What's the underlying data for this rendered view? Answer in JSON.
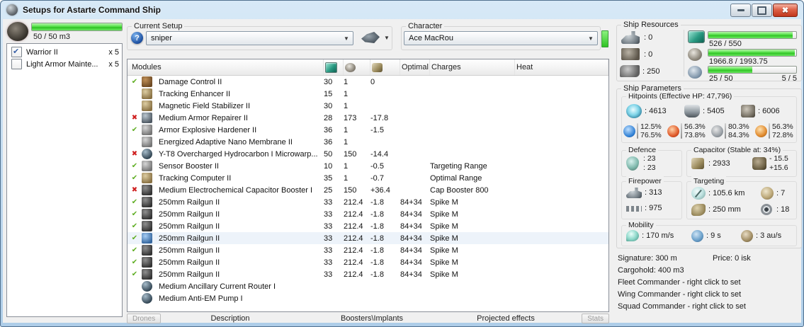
{
  "window": {
    "title": "Setups for Astarte Command Ship"
  },
  "drone_panel": {
    "capacity_text": "50 / 50 m3",
    "capacity_pct": 100,
    "items": [
      {
        "label": "Warrior II",
        "qty": "x 5",
        "checked": true
      },
      {
        "label": "Light Armor Mainte...",
        "qty": "x 5",
        "checked": false
      }
    ]
  },
  "setup": {
    "label": "Current Setup",
    "value": "sniper"
  },
  "character": {
    "label": "Character",
    "value": "Ace MacRou"
  },
  "modules_table": {
    "headers": {
      "modules": "Modules",
      "optimal": "Optimal",
      "charges": "Charges",
      "heat": "Heat"
    },
    "rows": [
      {
        "status": "ok",
        "icon": "damage-control-icon",
        "tone": "brown",
        "n": "Damage Control II",
        "cpu": "30",
        "pg": "1",
        "cap": "0"
      },
      {
        "status": "",
        "icon": "tracking-enhancer-icon",
        "tone": "tan",
        "n": "Tracking Enhancer II",
        "cpu": "15",
        "pg": "1"
      },
      {
        "status": "",
        "icon": "magnetic-field-stabilizer-icon",
        "tone": "tan",
        "n": "Magnetic Field Stabilizer II",
        "cpu": "30",
        "pg": "1"
      },
      {
        "status": "err",
        "icon": "armor-repairer-icon",
        "tone": "steel",
        "n": "Medium Armor Repairer II",
        "cpu": "28",
        "pg": "173",
        "cap": "-17.8"
      },
      {
        "status": "ok",
        "icon": "armor-hardener-icon",
        "tone": "gray",
        "n": "Armor Explosive Hardener II",
        "cpu": "36",
        "pg": "1",
        "cap": "-1.5"
      },
      {
        "status": "",
        "icon": "nano-membrane-icon",
        "tone": "gray",
        "n": "Energized Adaptive Nano Membrane II",
        "cpu": "36",
        "pg": "1"
      },
      {
        "status": "err",
        "icon": "microwarpdrive-icon",
        "tone": "orb",
        "n": "Y-T8 Overcharged Hydrocarbon I Microwarp...",
        "cpu": "50",
        "pg": "150",
        "cap": "-14.4"
      },
      {
        "status": "ok",
        "icon": "sensor-booster-icon",
        "tone": "gray",
        "n": "Sensor Booster II",
        "cpu": "10",
        "pg": "1",
        "cap": "-0.5",
        "chg": "Targeting Range"
      },
      {
        "status": "ok",
        "icon": "tracking-computer-icon",
        "tone": "tan",
        "n": "Tracking Computer II",
        "cpu": "35",
        "pg": "1",
        "cap": "-0.7",
        "chg": "Optimal Range"
      },
      {
        "status": "err",
        "icon": "capacitor-booster-icon",
        "tone": "dark",
        "n": "Medium Electrochemical Capacitor Booster I",
        "cpu": "25",
        "pg": "150",
        "cap": "+36.4",
        "chg": "Cap Booster 800"
      },
      {
        "status": "ok",
        "icon": "railgun-icon",
        "tone": "dark",
        "n": "250mm Railgun II",
        "cpu": "33",
        "pg": "212.4",
        "cap": "-1.8",
        "opt": "84+34",
        "chg": "Spike M"
      },
      {
        "status": "ok",
        "icon": "railgun-icon",
        "tone": "dark",
        "n": "250mm Railgun II",
        "cpu": "33",
        "pg": "212.4",
        "cap": "-1.8",
        "opt": "84+34",
        "chg": "Spike M"
      },
      {
        "status": "ok",
        "icon": "railgun-icon",
        "tone": "dark",
        "n": "250mm Railgun II",
        "cpu": "33",
        "pg": "212.4",
        "cap": "-1.8",
        "opt": "84+34",
        "chg": "Spike M"
      },
      {
        "status": "ok",
        "icon": "railgun-icon",
        "tone": "blue",
        "n": "250mm Railgun II",
        "cpu": "33",
        "pg": "212.4",
        "cap": "-1.8",
        "opt": "84+34",
        "chg": "Spike M",
        "sel": true
      },
      {
        "status": "ok",
        "icon": "railgun-icon",
        "tone": "dark",
        "n": "250mm Railgun II",
        "cpu": "33",
        "pg": "212.4",
        "cap": "-1.8",
        "opt": "84+34",
        "chg": "Spike M"
      },
      {
        "status": "ok",
        "icon": "railgun-icon",
        "tone": "dark",
        "n": "250mm Railgun II",
        "cpu": "33",
        "pg": "212.4",
        "cap": "-1.8",
        "opt": "84+34",
        "chg": "Spike M"
      },
      {
        "status": "ok",
        "icon": "railgun-icon",
        "tone": "dark",
        "n": "250mm Railgun II",
        "cpu": "33",
        "pg": "212.4",
        "cap": "-1.8",
        "opt": "84+34",
        "chg": "Spike M"
      },
      {
        "status": "",
        "icon": "ancillary-current-router-icon",
        "tone": "orb",
        "n": "Medium Ancillary Current Router I"
      },
      {
        "status": "",
        "icon": "anti-em-pump-icon",
        "tone": "orb",
        "n": "Medium Anti-EM Pump I"
      }
    ]
  },
  "footer": {
    "drones_button": "Drones",
    "tabs": [
      "Description",
      "Boosters\\Implants",
      "Projected effects"
    ],
    "stats_button": "Stats"
  },
  "ship_resources": {
    "title": "Ship Resources",
    "slots": [
      {
        "name": "turret-hardpoints",
        "value": ": 0"
      },
      {
        "name": "launcher-hardpoints",
        "value": ": 0"
      },
      {
        "name": "rig-calibration",
        "value": ": 250"
      }
    ],
    "cpu": {
      "text": "526 / 550",
      "pct": 95.6
    },
    "powergrid": {
      "text": "1966.8 / 1993.75",
      "pct": 98.6
    },
    "calibration": {
      "text": "25 / 50",
      "right": "5 / 5",
      "pct": 50
    }
  },
  "ship_parameters": {
    "title": "Ship Parameters",
    "hitpoints": {
      "title": "Hitpoints (Effective HP: 47,796)",
      "shield": ": 4613",
      "armor": ": 5405",
      "structure": ": 6006",
      "resists": [
        {
          "type": "em",
          "top": "12.5%",
          "bottom": "76.5%"
        },
        {
          "type": "thermal",
          "top": "56.3%",
          "bottom": "73.8%"
        },
        {
          "type": "kinetic",
          "top": "80.3%",
          "bottom": "84.3%"
        },
        {
          "type": "explosive",
          "top": "56.3%",
          "bottom": "72.8%"
        }
      ]
    },
    "defence": {
      "title": "Defence",
      "line1": ": 23",
      "line2": ": 23"
    },
    "capacitor": {
      "title": "Capacitor (Stable at: 34%)",
      "amount": ": 2933",
      "minus": "- 15.5",
      "plus": "+15.6"
    },
    "firepower": {
      "title": "Firepower",
      "turret": ": 313",
      "volley": ": 975"
    },
    "targeting": {
      "title": "Targeting",
      "range": ": 105.6 km",
      "max_targets": ": 7",
      "scan_res": ": 250 mm",
      "sensor": ": 18"
    },
    "mobility": {
      "title": "Mobility",
      "speed": ": 170 m/s",
      "align": ": 9 s",
      "warp": ": 3 au/s"
    }
  },
  "info": {
    "signature": "Signature: 300 m",
    "price": "Price: 0 isk",
    "cargohold": "Cargohold: 400 m3",
    "fleet": "Fleet Commander - right click to set",
    "wing": "Wing Commander - right click to set",
    "squad": "Squad Commander - right click to set"
  }
}
